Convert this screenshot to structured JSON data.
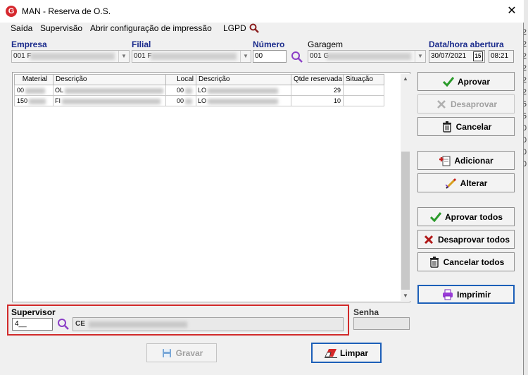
{
  "window": {
    "title": "MAN - Reserva de O.S.",
    "app_icon_letter": "G",
    "close_glyph": "✕"
  },
  "menu": {
    "items": [
      "Saída",
      "Supervisão",
      "Abrir configuração de impressão",
      "LGPD"
    ]
  },
  "header_fields": {
    "empresa": {
      "label": "Empresa",
      "value": "001 F"
    },
    "filial": {
      "label": "Filial",
      "value": "001 F"
    },
    "numero": {
      "label": "Número",
      "value": "00"
    },
    "garagem": {
      "label": "Garagem",
      "value": "001 G"
    },
    "data_hora": {
      "label": "Data/hora abertura",
      "date": "30/07/2021",
      "time": "08:21",
      "calendar_glyph": "15"
    }
  },
  "grid": {
    "columns": [
      "Material",
      "Descrição",
      "Local",
      "Descrição",
      "Qtde reservada",
      "Situação"
    ],
    "rows": [
      {
        "material": "00",
        "descricao": "OL",
        "local": "00",
        "descricao2": "LO",
        "qtde": "29",
        "situacao": ""
      },
      {
        "material": "150",
        "descricao": "FI",
        "local": "00",
        "descricao2": "LO",
        "qtde": "10",
        "situacao": ""
      }
    ]
  },
  "buttons": {
    "aprovar": "Aprovar",
    "desaprovar": "Desaprovar",
    "cancelar": "Cancelar",
    "adicionar": "Adicionar",
    "alterar": "Alterar",
    "aprovar_todos": "Aprovar todos",
    "desaprovar_todos": "Desaprovar todos",
    "cancelar_todos": "Cancelar todos",
    "imprimir": "Imprimir",
    "gravar": "Gravar",
    "limpar": "Limpar"
  },
  "supervisor": {
    "label": "Supervisor",
    "code": "4__",
    "name_prefix": "CE"
  },
  "senha": {
    "label": "Senha"
  },
  "background_window": {
    "digits": [
      "2",
      "2",
      "2",
      "2",
      "2",
      "2",
      "5",
      "5",
      "0",
      "0",
      "0",
      "0"
    ]
  },
  "colors": {
    "label_blue": "#1a2b8c",
    "highlight_red": "#d12a2a",
    "approve_green": "#2a9a2a",
    "disapprove_red": "#b01818",
    "focus_blue": "#1c5fb8",
    "search_purple": "#7a2ab8"
  }
}
